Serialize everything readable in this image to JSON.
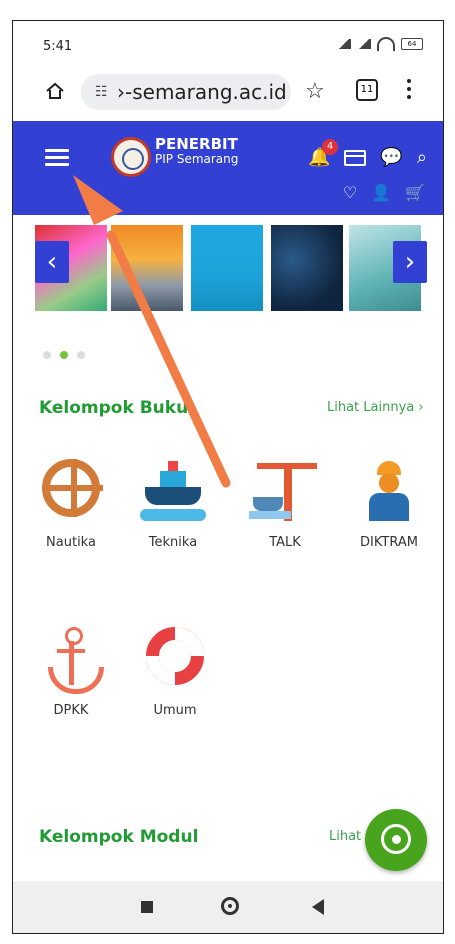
{
  "status": {
    "time": "5:41",
    "battery": "64"
  },
  "browser": {
    "url": "›-semarang.ac.id",
    "tabs_count": "11"
  },
  "site": {
    "brand_name": "PENERBIT",
    "brand_sub": "PIP Semarang",
    "notification_count": "4"
  },
  "pagination": {
    "active_index": 1,
    "count": 3
  },
  "section_books": {
    "title": "Kelompok Buku",
    "link": "Lihat Lainnya ›",
    "items": [
      {
        "label": "Nautika",
        "icon": "ship-wheel-icon"
      },
      {
        "label": "Teknika",
        "icon": "ship-icon"
      },
      {
        "label": "TALK",
        "icon": "port-crane-icon"
      },
      {
        "label": "DIKTRAM",
        "icon": "worker-icon"
      },
      {
        "label": "DPKK",
        "icon": "anchor-icon"
      },
      {
        "label": "Umum",
        "icon": "lifebuoy-icon"
      }
    ]
  },
  "section_modules": {
    "title": "Kelompok Modul",
    "link": "Lihat"
  },
  "colors": {
    "header_blue": "#3240d4",
    "section_green": "#219b33",
    "whatsapp_green": "#47a41c",
    "annotation_arrow": "#f27c45"
  }
}
